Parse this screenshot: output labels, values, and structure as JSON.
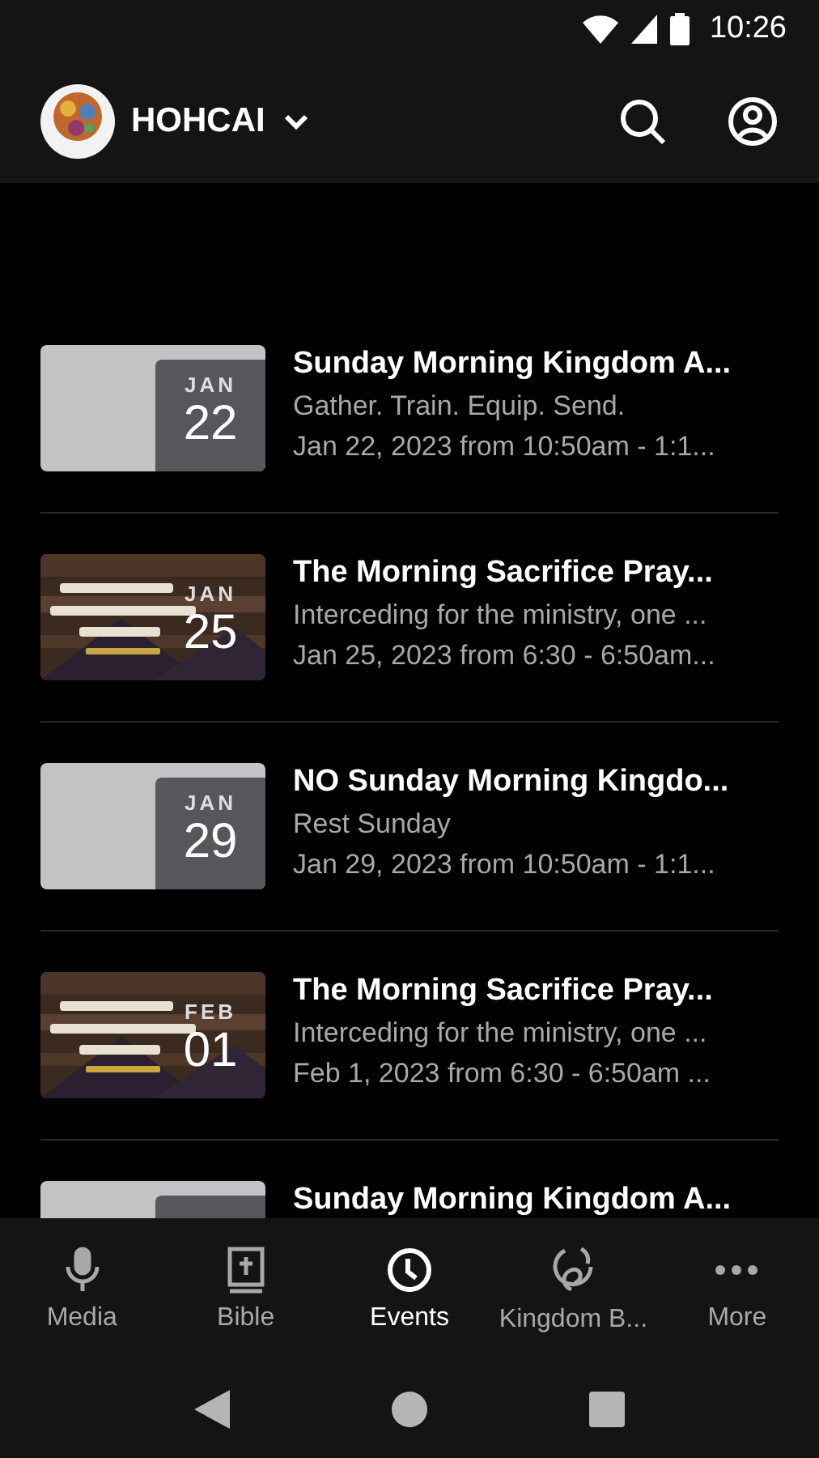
{
  "status_bar": {
    "time": "10:26"
  },
  "app_bar": {
    "title": "HOHCAI"
  },
  "events": [
    {
      "thumbnail": {
        "kind": "placeholder"
      },
      "month": "JAN",
      "day": "22",
      "title": "Sunday Morning Kingdom A...",
      "subtitle": "Gather. Train. Equip. Send.",
      "when": "Jan 22, 2023 from 10:50am - 1:1..."
    },
    {
      "month": "JAN",
      "day": "25",
      "title": "The Morning Sacrifice Pray...",
      "subtitle": "Interceding for the ministry, one ...",
      "when": "Jan 25, 2023 from 6:30 - 6:50am..."
    },
    {
      "thumbnail": {
        "kind": "placeholder"
      },
      "month": "JAN",
      "day": "29",
      "title": "NO Sunday Morning Kingdo...",
      "subtitle": "Rest Sunday",
      "when": "Jan 29, 2023 from 10:50am - 1:1..."
    },
    {
      "month": "FEB",
      "day": "01",
      "title": "The Morning Sacrifice Pray...",
      "subtitle": "Interceding for the ministry, one ...",
      "when": "Feb 1, 2023 from 6:30 - 6:50am ..."
    },
    {
      "thumbnail": {
        "kind": "placeholder"
      },
      "title": "Sunday Morning Kingdom A..."
    }
  ],
  "tabs": [
    {
      "label": "Media",
      "kind": "mic",
      "selected": false
    },
    {
      "label": "Bible",
      "kind": "bible",
      "selected": false
    },
    {
      "label": "Events",
      "kind": "clock",
      "selected": true
    },
    {
      "label": "Kingdom B...",
      "kind": "swirl",
      "selected": false
    },
    {
      "label": "More",
      "kind": "dots",
      "selected": false
    }
  ]
}
